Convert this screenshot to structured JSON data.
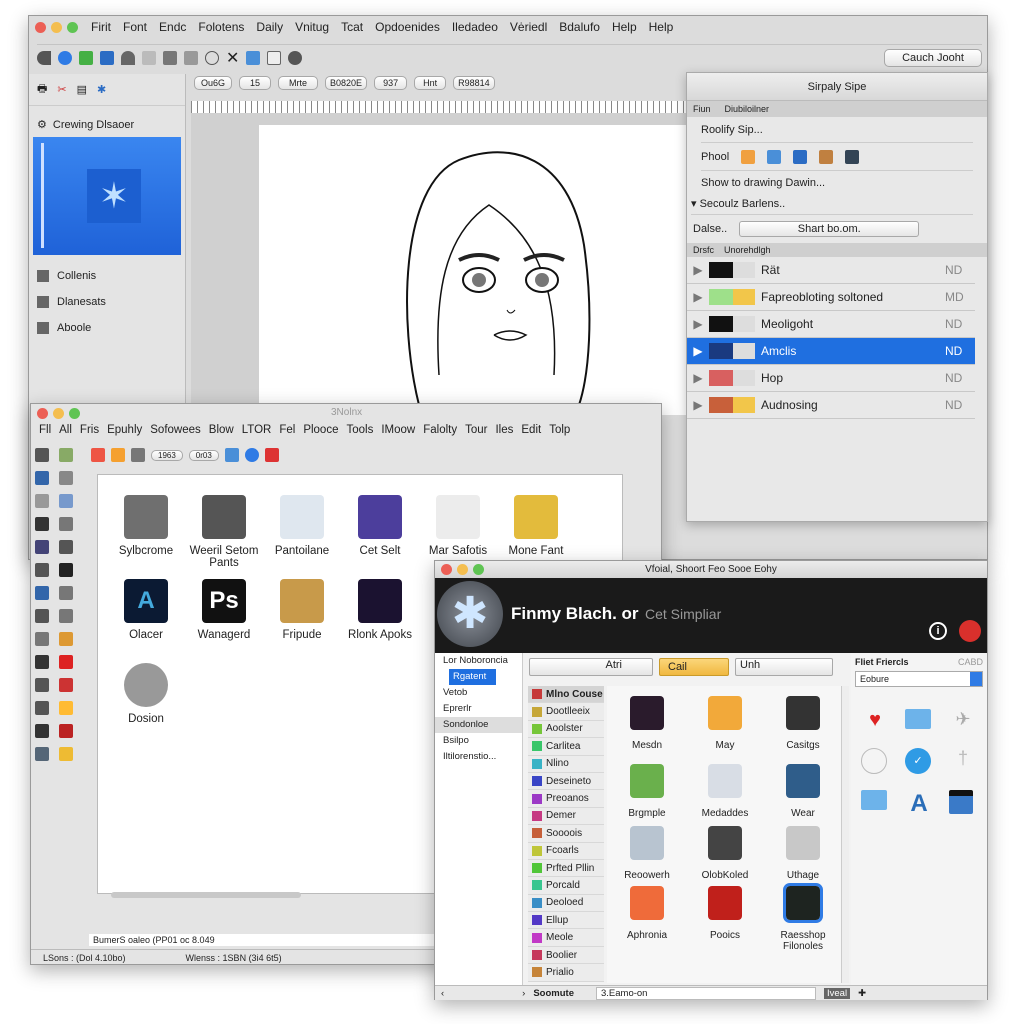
{
  "main": {
    "menu": [
      "Firit",
      "Font",
      "Endc",
      "Folotens",
      "Daily",
      "Vnitug",
      "Tcat",
      "Opdoenides",
      "Iledadeo",
      "Vėriedl",
      "Bdalufo",
      "Help",
      "Help"
    ],
    "search_label": "Cauch Jooht",
    "format_bar": {
      "font": "Ou6G",
      "size": "15",
      "style": "Mrte",
      "color": "B0820E",
      "zoom": "937",
      "unit": "Hnt",
      "code": "R98814"
    },
    "sidebar": {
      "header": "Crewing Dlsaoer",
      "items": [
        "Collenis",
        "Dlanesats",
        "Aboole"
      ]
    },
    "panel": {
      "title": "Sirpaly Sipe",
      "tabs": [
        "Fiun",
        "Diubiloilner"
      ],
      "rows": [
        "Roolify Sip...",
        "Phool",
        "Show to drawing Dawin...",
        "Secoulz Barlens.."
      ],
      "select_label": "Dalse..",
      "select_value": "Shart bo.om.",
      "layers_tabs": [
        "Drsfc",
        "Unorehdlgh"
      ],
      "layers": [
        {
          "name": "Rät",
          "tag": "ND"
        },
        {
          "name": "Fapreobloting soltoned",
          "tag": "MD"
        },
        {
          "name": "Meoligoht",
          "tag": "ND"
        },
        {
          "name": "Amclis",
          "tag": "ND",
          "selected": true
        },
        {
          "name": "Hop",
          "tag": "ND"
        },
        {
          "name": "Audnosing",
          "tag": "ND"
        }
      ]
    }
  },
  "win2": {
    "title": "3Nolnx",
    "menu": [
      "Fll",
      "All",
      "Fris",
      "Epuhly",
      "Sofowees",
      "Blow",
      "LTOR",
      "Fel",
      "Plooce",
      "Tools",
      "IMoow",
      "Falolty",
      "Tour",
      "Iles",
      "Edit",
      "Tolp"
    ],
    "fields": [
      "1963",
      "0r03"
    ],
    "apps": [
      {
        "label": "Sylbcrome",
        "color": "#6f6f6f"
      },
      {
        "label": "Weeril Setom Pants",
        "color": "#555"
      },
      {
        "label": "Pantoilane",
        "color": "#dfe7ef"
      },
      {
        "label": "Cet Selt",
        "color": "#4c3e9c"
      },
      {
        "label": "Mar Safotis",
        "color": "#ececec"
      },
      {
        "label": "Mone Fant",
        "color": "#e3bb3c"
      },
      {
        "label": "Olacer",
        "color": "#0b1a33",
        "glyph": "A"
      },
      {
        "label": "Wanagerd",
        "color": "#111",
        "glyph": "Ps"
      },
      {
        "label": "Fripude",
        "color": "#c89a4a"
      },
      {
        "label": "Rlonk Apoks",
        "color": "#1b1230"
      },
      {
        "label": "Dosion",
        "color": "#999"
      }
    ],
    "status1": "BumerS oaleo (PP01 oc 8.049",
    "status2a": "LSons : (Dol 4.10bo)",
    "status2b": "Wlenss : 1SBN (3i4 6t5)"
  },
  "win3": {
    "title": "Vfoial, Shoort Feo Sooe Eohy",
    "app_name": "Finmy Blach. or",
    "subtitle": "Cet Simpliar",
    "sidebar": [
      "Lor Noboroncia",
      "Rgatent",
      "Vetob",
      "Eprerlr",
      "Sondonloe",
      "Bsilpo",
      "Iltilorenstio..."
    ],
    "search_left": "Atri",
    "category_select": "Cail",
    "search_right": "Unh",
    "categories": [
      "Mlno Couse",
      "Dootlleeix",
      "Aoolster",
      "Carlitea",
      "Nlino",
      "Deseineto",
      "Preoanos",
      "Demer",
      "Soooois",
      "Fcoarls",
      "Prfted Pllin",
      "Porcald",
      "Deoloed",
      "Ellup",
      "Meole",
      "Boolier",
      "Prialio"
    ],
    "apps": [
      {
        "label": "Mesdn",
        "color": "#2a1b2c"
      },
      {
        "label": "May",
        "color": "#f2a93a"
      },
      {
        "label": "Casitgs",
        "color": "#333"
      },
      {
        "label": "Brgmple",
        "color": "#6ab04c"
      },
      {
        "label": "Medaddes",
        "color": "#d8dde5"
      },
      {
        "label": "Wear",
        "color": "#2f5d8a"
      },
      {
        "label": "Reoowerh",
        "color": "#b8c4d0"
      },
      {
        "label": "OlobKoled",
        "color": "#444"
      },
      {
        "label": "Uthage",
        "color": "#c8c8c8"
      },
      {
        "label": "Aphronia",
        "color": "#ef6b3a"
      },
      {
        "label": "Pooics",
        "color": "#c0201b"
      },
      {
        "label": "Raesshop Filonoles",
        "color": "#1e2420"
      }
    ],
    "right_title": "Fliet Friercls",
    "right_tag": "CABD",
    "right_select": "Eobure",
    "bottom_label": "Soomute",
    "bottom_field": "3.Eamo-on",
    "bottom_btn": "Iveal"
  },
  "colors": {
    "accent": "#1f6fe0",
    "header_dark": "#1a1a1a"
  }
}
